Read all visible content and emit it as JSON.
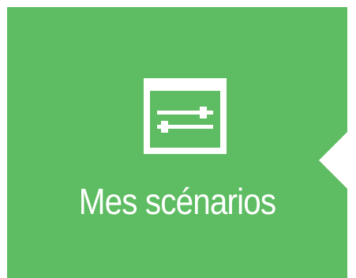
{
  "tile": {
    "label": "Mes scénarios",
    "icon": "sliders-settings-icon",
    "background_color": "#5ebc62",
    "foreground_color": "#ffffff"
  }
}
